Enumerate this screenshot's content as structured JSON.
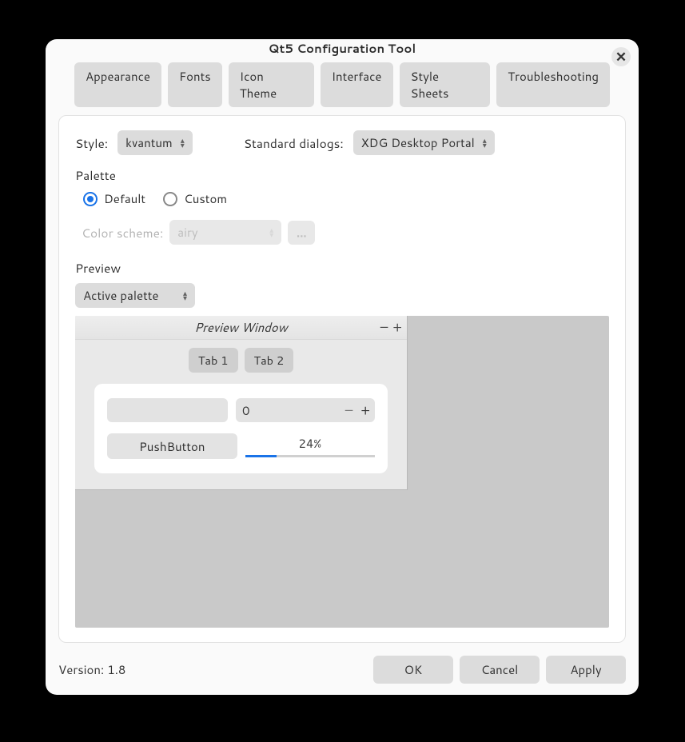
{
  "window": {
    "title": "Qt5 Configuration Tool"
  },
  "tabs": [
    "Appearance",
    "Fonts",
    "Icon Theme",
    "Interface",
    "Style Sheets",
    "Troubleshooting"
  ],
  "style": {
    "label": "Style:",
    "value": "kvantum"
  },
  "dialogs": {
    "label": "Standard dialogs:",
    "value": "XDG Desktop Portal"
  },
  "palette": {
    "heading": "Palette",
    "default": "Default",
    "custom": "Custom",
    "selected": "default",
    "scheme_label": "Color scheme:",
    "scheme_value": "airy",
    "ellipsis": "..."
  },
  "preview": {
    "heading": "Preview",
    "palette_mode": "Active palette",
    "window_title": "Preview Window",
    "min_symbol": "–",
    "max_symbol": "+",
    "tabs": [
      "Tab 1",
      "Tab 2"
    ],
    "spin_value": "0",
    "spin_minus": "–",
    "spin_plus": "+",
    "push_label": "PushButton",
    "progress_label": "24%",
    "progress_pct": 24
  },
  "footer": {
    "version": "Version: 1.8",
    "ok": "OK",
    "cancel": "Cancel",
    "apply": "Apply"
  }
}
